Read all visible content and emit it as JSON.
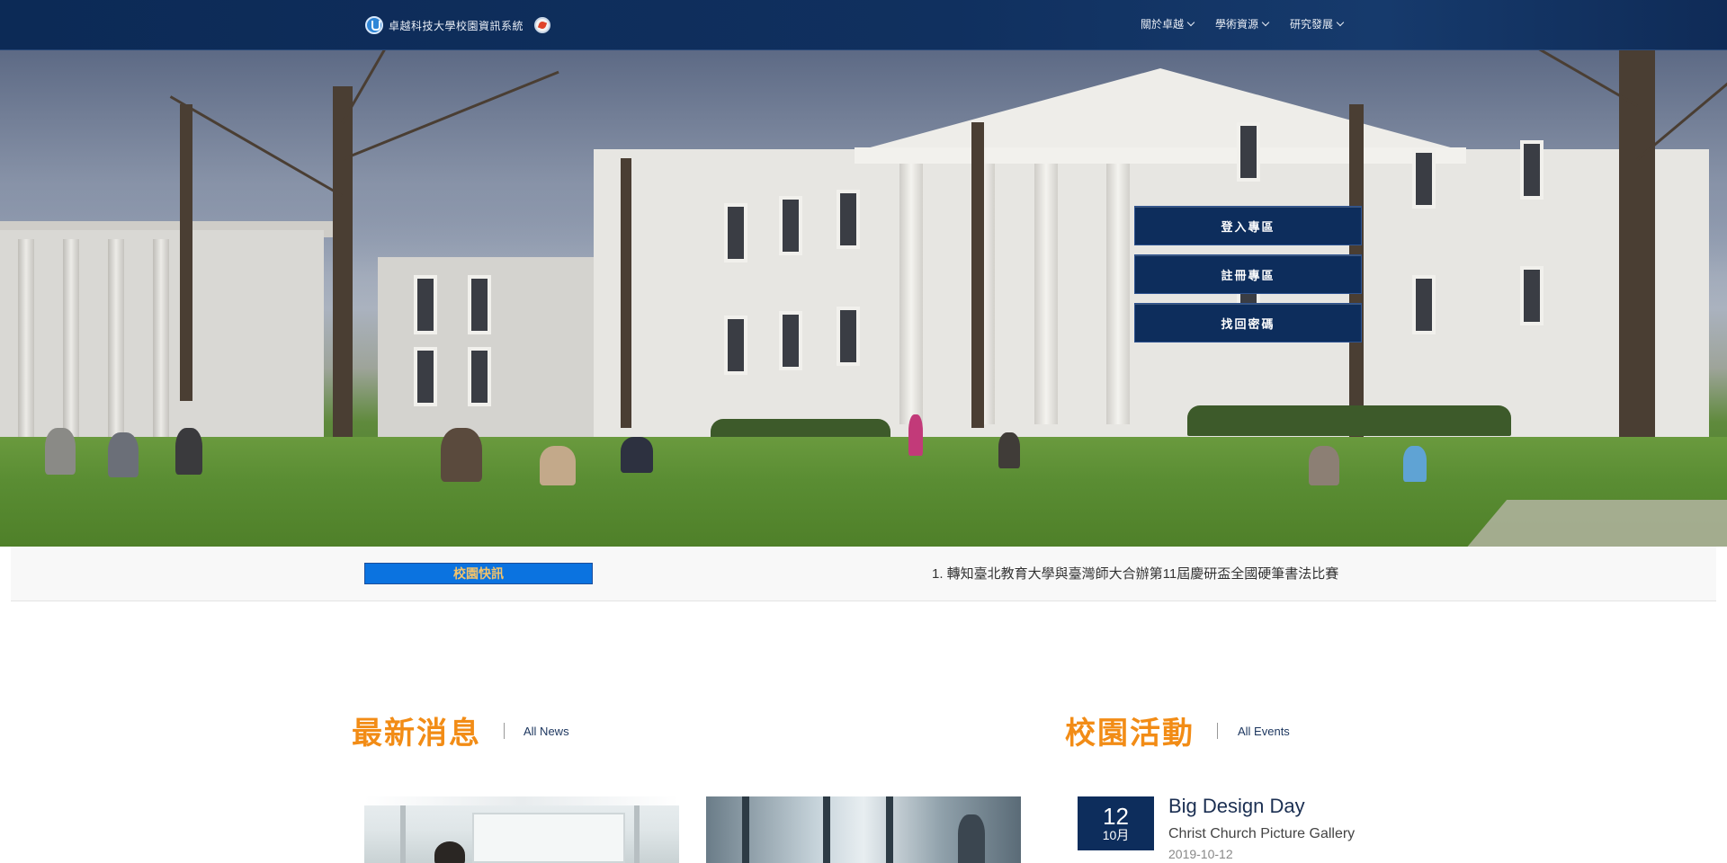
{
  "header": {
    "site_title": "卓越科技大學校園資訊系統",
    "nav": [
      {
        "label": "關於卓越"
      },
      {
        "label": "學術資源"
      },
      {
        "label": "研究發展"
      }
    ]
  },
  "hero": {
    "buttons": [
      {
        "label": "登入專區"
      },
      {
        "label": "註冊專區"
      },
      {
        "label": "找回密碼"
      }
    ]
  },
  "ticker": {
    "label": "校園快訊",
    "text": "1. 轉知臺北教育大學與臺灣師大合辦第11屆慶研盃全國硬筆書法比賽"
  },
  "news": {
    "title": "最新消息",
    "link": "All News"
  },
  "events": {
    "title": "校園活動",
    "link": "All Events",
    "items": [
      {
        "day": "12",
        "month": "10月",
        "title": "Big Design Day",
        "place": "Christ Church Picture Gallery",
        "date": "2019-10-12"
      }
    ]
  },
  "colors": {
    "navy": "#0d2d5c",
    "accent_orange": "#f28c16",
    "ticker_blue": "#0b73e0",
    "ticker_label_text": "#f3c36a"
  },
  "icons": [
    "university-logo-icon",
    "badge-icon",
    "chevron-down-icon"
  ]
}
